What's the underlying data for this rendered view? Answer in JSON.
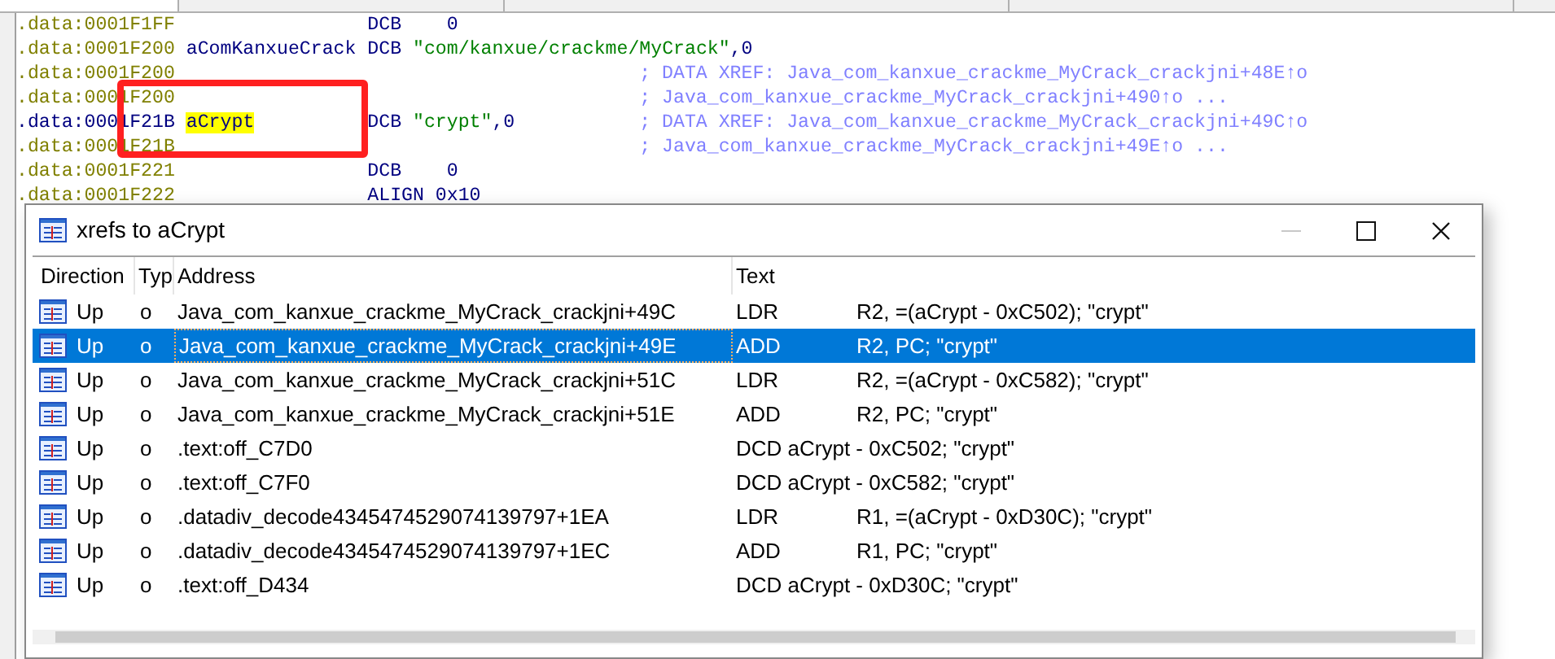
{
  "disassembly": {
    "lines": [
      {
        "address": ".data:0001F1FF",
        "instruction": "DCB    0",
        "current": false
      },
      {
        "address": ".data:0001F200",
        "label": "aComKanxueCrack",
        "instruction": "DCB \"com/kanxue/crackme/MyCrack\",0",
        "current": false,
        "label_highlighted": false
      },
      {
        "address": ".data:0001F200",
        "comment": "; DATA XREF: Java_com_kanxue_crackme_MyCrack_crackjni+48E↑o",
        "current": false
      },
      {
        "address": ".data:0001F200",
        "comment": "; Java_com_kanxue_crackme_MyCrack_crackjni+490↑o ...",
        "current": false
      },
      {
        "address": ".data:0001F21B",
        "label": "aCrypt",
        "instruction": "DCB \"crypt\",0",
        "comment": "; DATA XREF: Java_com_kanxue_crackme_MyCrack_crackjni+49C↑o",
        "current": true,
        "label_highlighted": true
      },
      {
        "address": ".data:0001F21B",
        "comment": "; Java_com_kanxue_crackme_MyCrack_crackjni+49E↑o ...",
        "current": false
      },
      {
        "address": ".data:0001F221",
        "instruction": "DCB    0",
        "current": false
      },
      {
        "address": ".data:0001F222",
        "instruction": "ALIGN 0x10",
        "current": false
      }
    ]
  },
  "annotation": {
    "kind": "rectangle"
  },
  "dialog": {
    "title": "xrefs to aCrypt",
    "minimize_disabled": true,
    "columns": [
      "Direction",
      "Typ",
      "Address",
      "Text"
    ],
    "rows": [
      {
        "direction": "Up",
        "type": "o",
        "address": "Java_com_kanxue_crackme_MyCrack_crackjni+49C",
        "text": "LDR",
        "operands": "R2, =(aCrypt - 0xC502); \"crypt\"",
        "selected": false
      },
      {
        "direction": "Up",
        "type": "o",
        "address": "Java_com_kanxue_crackme_MyCrack_crackjni+49E",
        "text": "ADD",
        "operands": "R2, PC; \"crypt\"",
        "selected": true
      },
      {
        "direction": "Up",
        "type": "o",
        "address": "Java_com_kanxue_crackme_MyCrack_crackjni+51C",
        "text": "LDR",
        "operands": "R2, =(aCrypt - 0xC582); \"crypt\"",
        "selected": false
      },
      {
        "direction": "Up",
        "type": "o",
        "address": "Java_com_kanxue_crackme_MyCrack_crackjni+51E",
        "text": "ADD",
        "operands": "R2, PC; \"crypt\"",
        "selected": false
      },
      {
        "direction": "Up",
        "type": "o",
        "address": ".text:off_C7D0",
        "text": "DCD aCrypt - 0xC502; \"crypt\"",
        "selected": false
      },
      {
        "direction": "Up",
        "type": "o",
        "address": ".text:off_C7F0",
        "text": "DCD aCrypt - 0xC582; \"crypt\"",
        "selected": false
      },
      {
        "direction": "Up",
        "type": "o",
        "address": ".datadiv_decode4345474529074139797+1EA",
        "text": "LDR",
        "operands": "R1, =(aCrypt - 0xD30C); \"crypt\"",
        "selected": false
      },
      {
        "direction": "Up",
        "type": "o",
        "address": ".datadiv_decode4345474529074139797+1EC",
        "text": "ADD",
        "operands": "R1, PC; \"crypt\"",
        "selected": false
      },
      {
        "direction": "Up",
        "type": "o",
        "address": ".text:off_D434",
        "text": "DCD aCrypt - 0xD30C; \"crypt\"",
        "selected": false
      }
    ]
  }
}
